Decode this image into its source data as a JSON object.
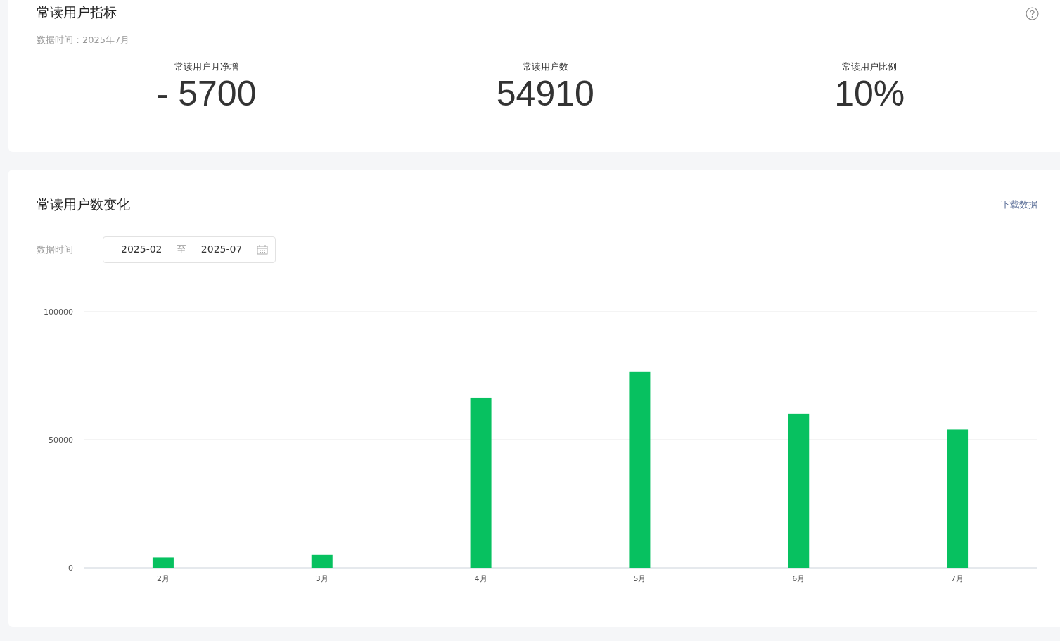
{
  "indicators": {
    "title": "常读用户指标",
    "data_time": "数据时间：2025年7月",
    "metrics": [
      {
        "label": "常读用户月净增",
        "value": "- 5700"
      },
      {
        "label": "常读用户数",
        "value": "54910"
      },
      {
        "label": "常读用户比例",
        "value": "10%"
      }
    ]
  },
  "trend": {
    "title": "常读用户数变化",
    "download_link": "下载数据",
    "filter_label": "数据时间",
    "date_range": {
      "start": "2025-02",
      "separator": "至",
      "end": "2025-07"
    },
    "chart_data": {
      "type": "bar",
      "categories": [
        "2月",
        "3月",
        "4月",
        "5月",
        "6月",
        "7月"
      ],
      "values": [
        4000,
        5000,
        66500,
        76700,
        60200,
        54000
      ],
      "ylim": [
        0,
        100000
      ],
      "yticks": [
        0,
        50000,
        100000
      ]
    }
  }
}
